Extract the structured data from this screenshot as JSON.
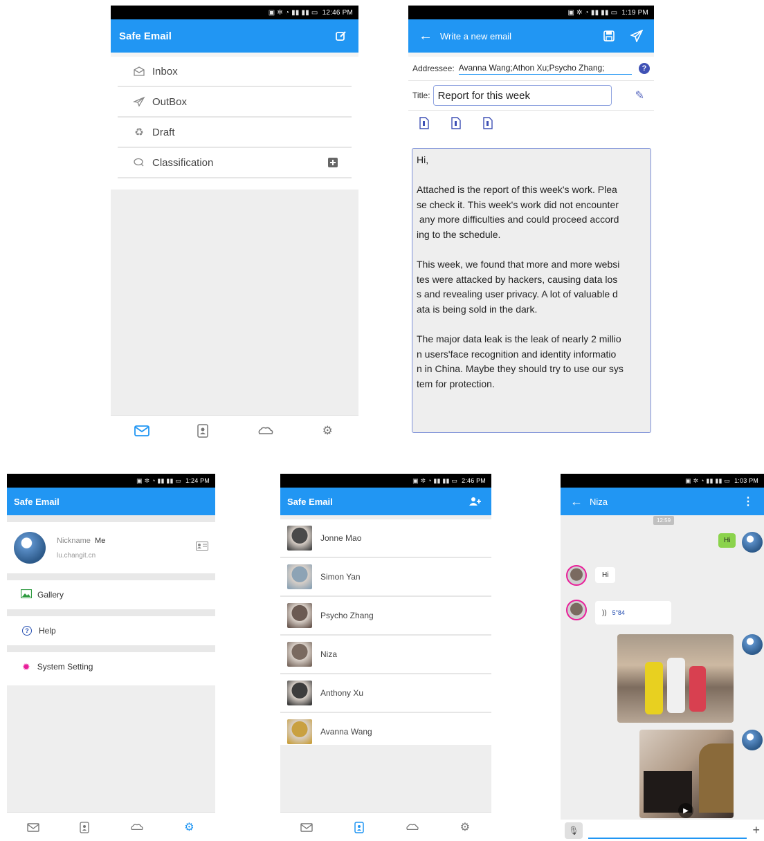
{
  "screen1": {
    "status_time": "12:46 PM",
    "title": "Safe Email",
    "menu": [
      {
        "label": "Inbox",
        "icon": "inbox-icon"
      },
      {
        "label": "OutBox",
        "icon": "send-icon"
      },
      {
        "label": "Draft",
        "icon": "recycle-icon"
      },
      {
        "label": "Classification",
        "icon": "chat-icon"
      }
    ]
  },
  "screen2": {
    "status_time": "1:19 PM",
    "title": "Write a new email",
    "addressee_label": "Addressee:",
    "addressee_value": "Avanna Wang;Athon Xu;Psycho Zhang;",
    "title_label": "Title:",
    "title_value": "Report for this week",
    "body": "Hi,\n\nAttached is the report of this week's work. Plea\nse check it. This week's work did not encounter\n any more difficulties and could proceed accord\ning to the schedule.\n\nThis week, we found that more and more websi\ntes were attacked by hackers, causing data los\ns and revealing user privacy. A lot of valuable d\nata is being sold in the dark.\n\nThe major data leak is the leak of nearly 2 millio\nn users'face recognition and identity informatio\nn in China. Maybe they should try to use our sys\ntem for protection."
  },
  "screen3": {
    "status_time": "1:24 PM",
    "title": "Safe Email",
    "nickname_label": "Nickname",
    "nickname_value": "Me",
    "domain": "lu.changit.cn",
    "items": [
      {
        "label": "Gallery",
        "icon": "gallery-icon"
      },
      {
        "label": "Help",
        "icon": "help-icon"
      },
      {
        "label": "System Setting",
        "icon": "gear-icon"
      }
    ]
  },
  "screen4": {
    "status_time": "2:46 PM",
    "title": "Safe Email",
    "contacts": [
      {
        "name": "Jonne Mao",
        "color": "#4a4a4a"
      },
      {
        "name": "Simon Yan",
        "color": "#8da3b5"
      },
      {
        "name": "Psycho Zhang",
        "color": "#6b5a52"
      },
      {
        "name": "Niza",
        "color": "#7a6a60"
      },
      {
        "name": "Anthony Xu",
        "color": "#3d3d3d"
      },
      {
        "name": "Avanna Wang",
        "color": "#c9a040"
      }
    ]
  },
  "screen5": {
    "status_time": "1:03 PM",
    "title": "Niza",
    "time_label": "12:59",
    "msg_sent": "Hi",
    "msg_recv": "Hi",
    "voice_duration": "5\"84"
  },
  "colors": {
    "primary": "#2196f3",
    "accent_pink": "#e91e9a",
    "bubble_green": "#8bd34c"
  }
}
